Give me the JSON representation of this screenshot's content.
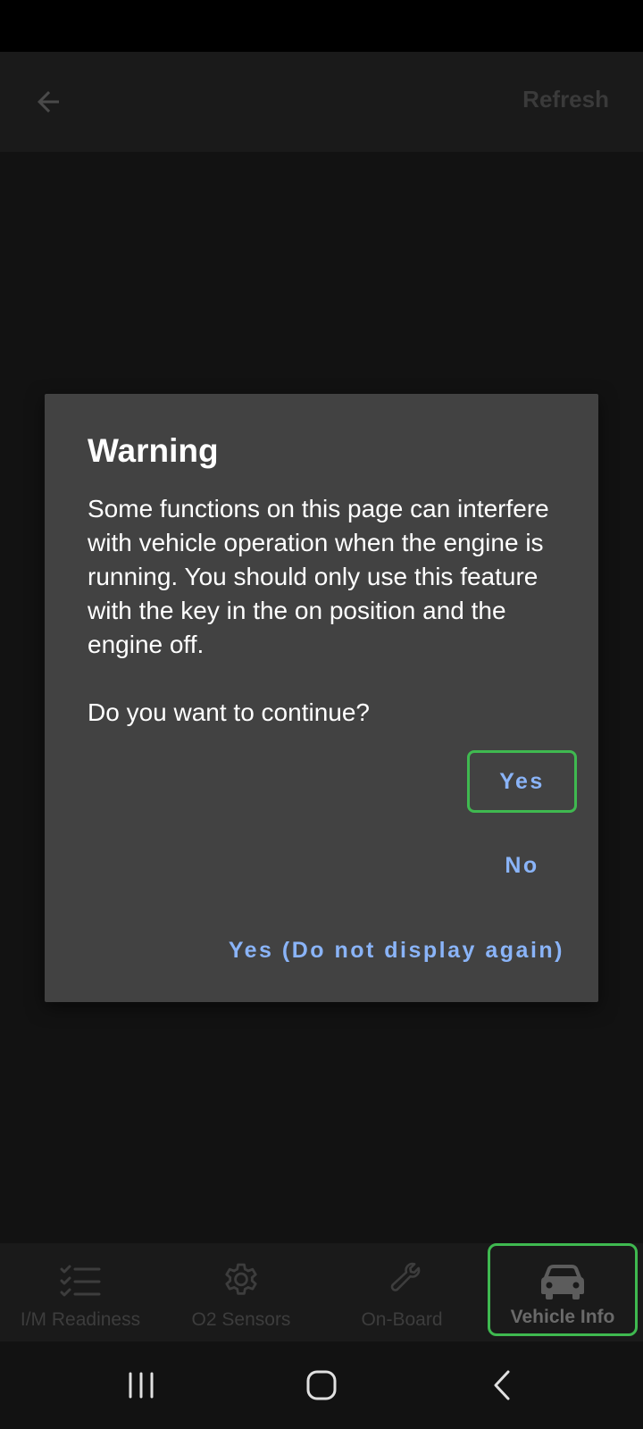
{
  "app_bar": {
    "back_icon": "arrow-left-icon",
    "refresh_label": "Refresh"
  },
  "dialog": {
    "title": "Warning",
    "message": "Some functions on this page can interfere with vehicle operation when the engine is running. You should only use this feature with the key in the on position and the engine off.",
    "question": "Do you want to continue?",
    "yes_label": "Yes",
    "no_label": "No",
    "yes_again_label": "Yes (Do not display again)"
  },
  "bottom_nav": {
    "items": [
      {
        "label": "I/M Readiness",
        "icon": "checklist-icon"
      },
      {
        "label": "O2 Sensors",
        "icon": "gear-icon"
      },
      {
        "label": "On-Board",
        "icon": "wrench-icon"
      },
      {
        "label": "Vehicle Info",
        "icon": "car-icon",
        "selected": true
      }
    ]
  },
  "system_nav": {
    "recents_icon": "recents-icon",
    "home_icon": "home-icon",
    "back_icon": "back-chevron-icon"
  },
  "colors": {
    "background": "#121212",
    "dialog_background": "#424242",
    "button_text": "#8ab4f8",
    "highlight_outline": "#3fb950"
  }
}
